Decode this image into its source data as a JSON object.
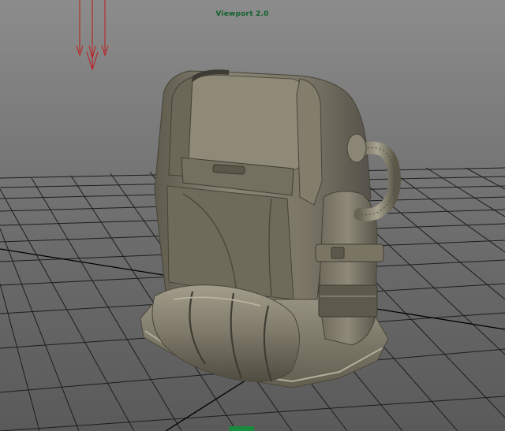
{
  "viewport": {
    "title": "Viewport 2.0",
    "label_color": "#12622e",
    "background_top": "#8c8c8c",
    "background_bottom": "#5a5a5a"
  },
  "grid": {
    "line_color": "#1d1d1d",
    "axis_color": "#000000"
  },
  "model": {
    "name_icon": "backpack-mesh",
    "base_color": "#7f7a68",
    "shadow_color": "#4e4b3f",
    "highlight_color": "#a7a290"
  },
  "light_gizmo": {
    "icon": "directional-light-icon",
    "color": "#c01a1a"
  },
  "hud": {
    "indicator_icon": "hud-tab-icon",
    "color": "#1a8a3e"
  }
}
